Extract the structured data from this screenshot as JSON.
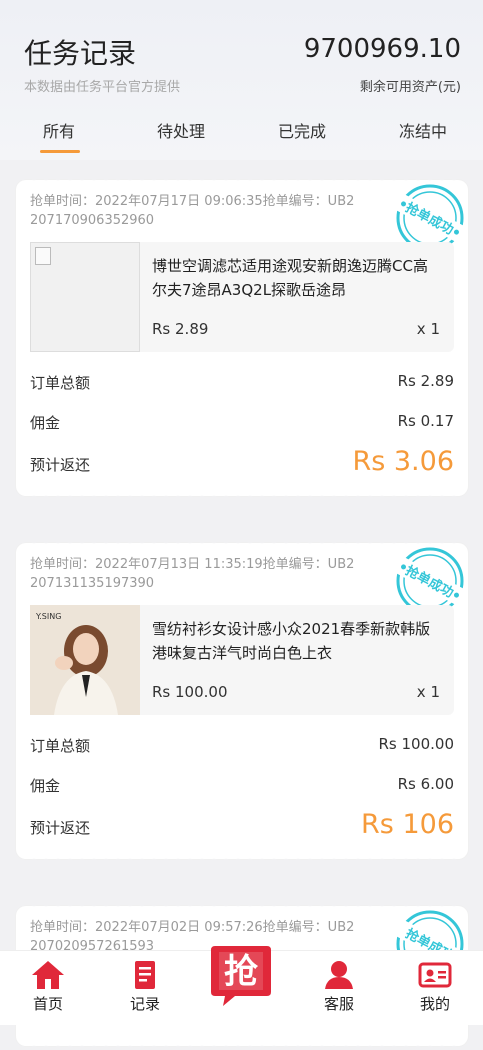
{
  "header": {
    "title": "任务记录",
    "subtitle": "本数据由任务平台官方提供",
    "balance": "9700969.10",
    "balance_label": "剩余可用资产(元)"
  },
  "tabs": [
    {
      "label": "所有",
      "active": true
    },
    {
      "label": "待处理",
      "active": false
    },
    {
      "label": "已完成",
      "active": false
    },
    {
      "label": "冻结中",
      "active": false
    }
  ],
  "stamp_text": "抢单成功",
  "labels": {
    "total": "订单总额",
    "commission": "佣金",
    "expected_return": "预计返还"
  },
  "orders": [
    {
      "meta": "抢单时间：2022年07月17日 09:06:35抢单编号：UB2207170906352960",
      "product_name": "博世空调滤芯适用途观安新朗逸迈腾CC高尔夫7途昂A3Q2L探歌岳途昂",
      "price": "Rs 2.89",
      "qty": "x 1",
      "total": "Rs 2.89",
      "commission": "Rs 0.17",
      "expected_return": "Rs 3.06"
    },
    {
      "meta": "抢单时间：2022年07月13日 11:35:19抢单编号：UB2207131135197390",
      "thumb_brand": "Y.SING",
      "product_name": "雪纺衬衫女设计感小众2021春季新款韩版港味复古洋气时尚白色上衣",
      "price": "Rs 100.00",
      "qty": "x 1",
      "total": "Rs 100.00",
      "commission": "Rs 6.00",
      "expected_return": "Rs 106"
    },
    {
      "meta": "抢单时间：2022年07月02日 09:57:26抢单编号：UB2207020957261593"
    }
  ],
  "nav": {
    "home": "首页",
    "records": "记录",
    "grab": "抢",
    "service": "客服",
    "mine": "我的"
  },
  "colors": {
    "accent": "#f59a3a",
    "stamp": "#34c6d8",
    "nav_red": "#e0283a"
  }
}
